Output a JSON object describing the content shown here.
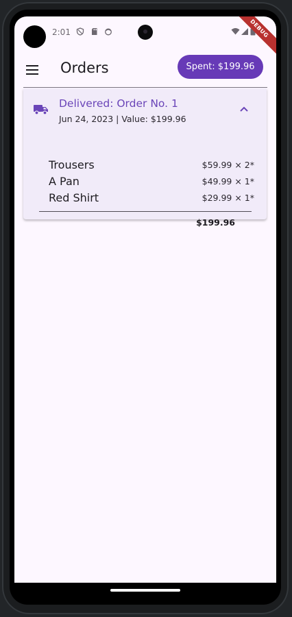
{
  "status_bar": {
    "time": "2:01",
    "icons": [
      "shield-icon",
      "sd-card-icon",
      "face-icon",
      "wifi-icon",
      "signal-icon",
      "battery-icon"
    ],
    "debug_label": "DEBUG"
  },
  "app_bar": {
    "title": "Orders",
    "menu_icon": "menu-icon",
    "spent_label": "Spent: $199.96"
  },
  "order": {
    "title": "Delivered: Order No. 1",
    "subtitle": "Jun 24, 2023 | Value: $199.96",
    "status_icon": "truck-icon",
    "expand_icon": "chevron-up-icon",
    "items": [
      {
        "name": "Trousers",
        "price": "$59.99 × 2*"
      },
      {
        "name": "A Pan",
        "price": "$49.99 × 1*"
      },
      {
        "name": "Red Shirt",
        "price": "$29.99 × 1*"
      }
    ],
    "total": "$199.96"
  },
  "colors": {
    "accent": "#673ab7",
    "accent_text": "#6a45b8",
    "card_background": "#f1ebf9",
    "screen_background": "#fdf7ff",
    "debug_ribbon": "#b8312f"
  }
}
